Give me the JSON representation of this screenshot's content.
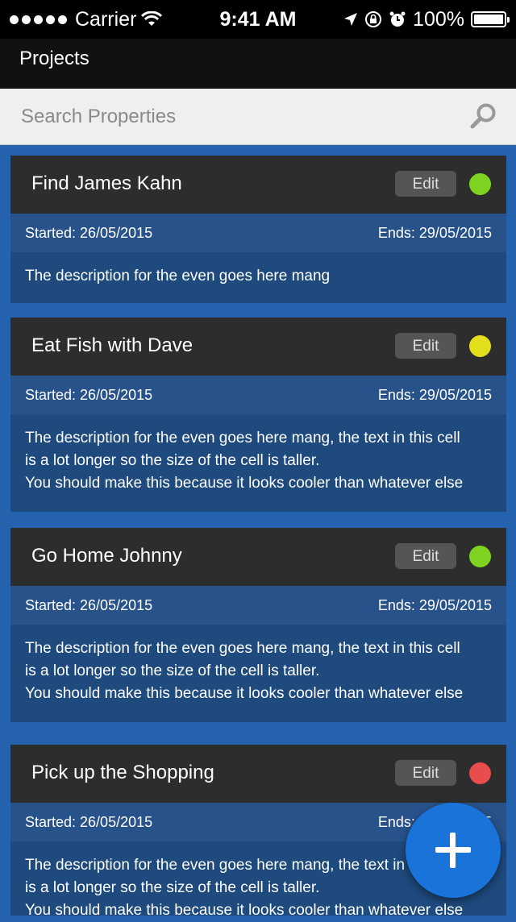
{
  "status_bar": {
    "carrier": "Carrier",
    "time": "9:41 AM",
    "battery": "100%"
  },
  "nav": {
    "title": "Projects"
  },
  "search": {
    "placeholder": "Search Properties",
    "value": ""
  },
  "projects": [
    {
      "title": "Find James Kahn",
      "edit_label": "Edit",
      "status_color": "#7ed321",
      "started": "Started: 26/05/2015",
      "ends": "Ends: 29/05/2015",
      "description": [
        "The description for the even goes here mang"
      ]
    },
    {
      "title": "Eat Fish with Dave",
      "edit_label": "Edit",
      "status_color": "#e3df1a",
      "started": "Started: 26/05/2015",
      "ends": "Ends: 29/05/2015",
      "description": [
        "The description for the even goes here mang, the text in this cell",
        "is a lot longer so the size of the cell is taller.",
        "You should make this because it looks cooler than whatever else"
      ]
    },
    {
      "title": "Go Home Johnny",
      "edit_label": "Edit",
      "status_color": "#7ed321",
      "started": "Started: 26/05/2015",
      "ends": "Ends: 29/05/2015",
      "description": [
        "The description for the even goes here mang, the text in this cell",
        "is a lot longer so the size of the cell is taller.",
        "You should make this because it looks cooler than whatever else"
      ]
    },
    {
      "title": "Pick up the Shopping",
      "edit_label": "Edit",
      "status_color": "#e84c4c",
      "started": "Started: 26/05/2015",
      "ends": "Ends: 29/05/2015",
      "description": [
        "The description for the even goes here mang, the text in this cell",
        "is a lot longer so the size of the cell is taller.",
        "You should make this because it looks cooler than whatever else"
      ]
    }
  ],
  "fab": {
    "icon": "plus-icon"
  }
}
